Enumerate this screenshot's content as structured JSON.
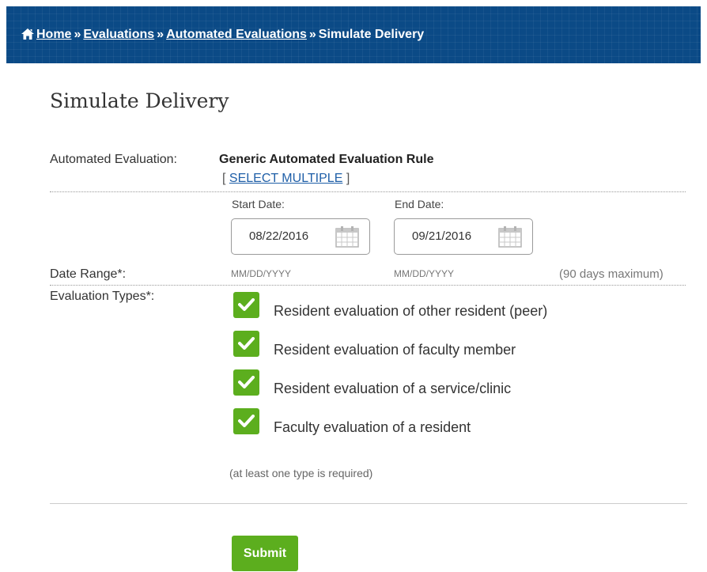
{
  "breadcrumb": {
    "home": "Home",
    "separator": "»",
    "evaluations": "Evaluations",
    "automated": "Automated Evaluations",
    "current": "Simulate Delivery",
    "icon": "home-icon"
  },
  "page_title": "Simulate Delivery",
  "automated_evaluation": {
    "label": "Automated Evaluation:",
    "value": "Generic Automated Evaluation Rule",
    "select_open": "[",
    "select_multiple": "SELECT MULTIPLE",
    "select_close": "]"
  },
  "date_range": {
    "label": "Date Range*:",
    "start_label": "Start Date:",
    "start_value": "08/22/2016",
    "start_hint": "MM/DD/YYYY",
    "end_label": "End Date:",
    "end_value": "09/21/2016",
    "end_hint": "MM/DD/YYYY",
    "max_note": "(90 days maximum)",
    "icon": "calendar-icon"
  },
  "evaluation_types": {
    "label": "Evaluation Types*:",
    "items": [
      {
        "label": "Resident evaluation of other resident (peer)",
        "checked": true
      },
      {
        "label": "Resident evaluation of faculty member",
        "checked": true
      },
      {
        "label": "Resident evaluation of a service/clinic",
        "checked": true
      },
      {
        "label": "Faculty evaluation of a resident",
        "checked": true
      }
    ],
    "note": "(at least one type is required)"
  },
  "submit_label": "Submit",
  "colors": {
    "header": "#0b4a86",
    "accent_green": "#5cae1e",
    "link": "#1f5fa8"
  }
}
